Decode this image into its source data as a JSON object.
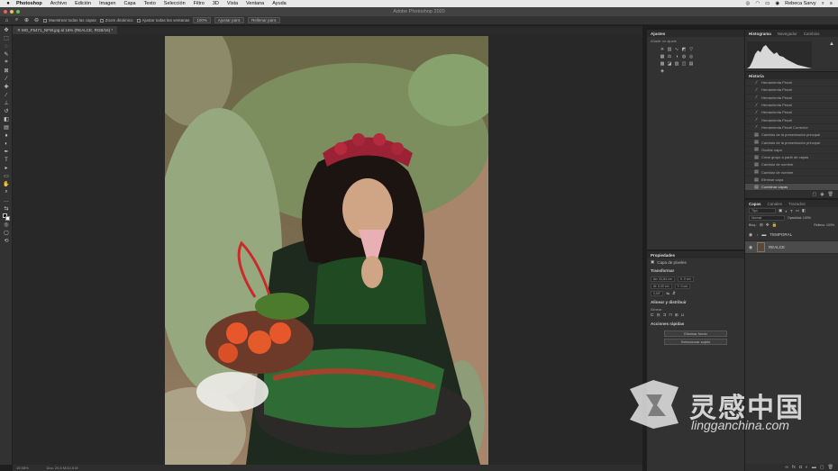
{
  "menubar": {
    "items": [
      "Photoshop",
      "Archivo",
      "Edición",
      "Imagen",
      "Capa",
      "Texto",
      "Selección",
      "Filtro",
      "3D",
      "Vista",
      "Ventana",
      "Ayuda"
    ],
    "user": "Rebeca Sarvy"
  },
  "window": {
    "title": "Adobe Photoshop 2020"
  },
  "options": {
    "sample_all": "Muestrear todas las capas",
    "scrubby": "Zoom dinámico",
    "fit_all": "Ajustar todas las ventanas",
    "fill": "Rellenar",
    "btn_100": "100%",
    "btn_fit": "Ajustar pant.",
    "btn_fill": "Rellenar pant."
  },
  "document": {
    "tab": "MG_F5471_NFW.jpg al 16% (REALCE, RGB/16) *"
  },
  "status": {
    "zoom": "15.58%",
    "doc": "Doc: 20,5 M/10,6 M"
  },
  "adjustments": {
    "tab": "Ajustes",
    "subtitle": "Añadir un ajuste"
  },
  "histogram": {
    "tabs": [
      "Histograma",
      "Navegador",
      "Cambios"
    ]
  },
  "history": {
    "title": "Historia",
    "items": [
      "Herramienta Pincel",
      "Herramienta Pincel",
      "Herramienta Pincel",
      "Herramienta Pincel",
      "Herramienta Pincel",
      "Herramienta Pincel",
      "Herramienta Pincel Corrector",
      "Cambiar de la presentación principal",
      "Cambiar de la presentación principal",
      "Ocultar capa",
      "Crear grupo a partir de capas",
      "Cambiar de nombre",
      "Cambiar de nombre",
      "Eliminar capa",
      "Combinar capas"
    ]
  },
  "properties": {
    "tab": "Propiedades",
    "layer_type": "Capa de píxeles",
    "transform": "Transformar",
    "w": "An: 31,64 cm",
    "x": "X: 0 cm",
    "h": "Al: 0,00 cm",
    "y": "Y: 0 cm",
    "angle": "0,00°",
    "align": "Alinear y distribuir",
    "align_sub": "Alinear:",
    "quick": "Acciones rápidas",
    "btn_remove": "Eliminar fondo",
    "btn_subject": "Seleccionar sujeto"
  },
  "layers": {
    "tabs": [
      "Capas",
      "Canales",
      "Trazados"
    ],
    "kind": "Tipo",
    "mode": "Normal",
    "opacity": "Opacidad: 100%",
    "lock": "Bloq.:",
    "fill": "Relleno: 100%",
    "rows": [
      {
        "name": "TEMPORAL",
        "type": "group"
      },
      {
        "name": "REALCE",
        "type": "pixel"
      }
    ]
  },
  "watermark": {
    "title": "灵感中国",
    "url": "lingganchina.com"
  },
  "colors": {
    "accent": "#4a4a4a",
    "panel": "#323232",
    "canvas": "#282828"
  }
}
